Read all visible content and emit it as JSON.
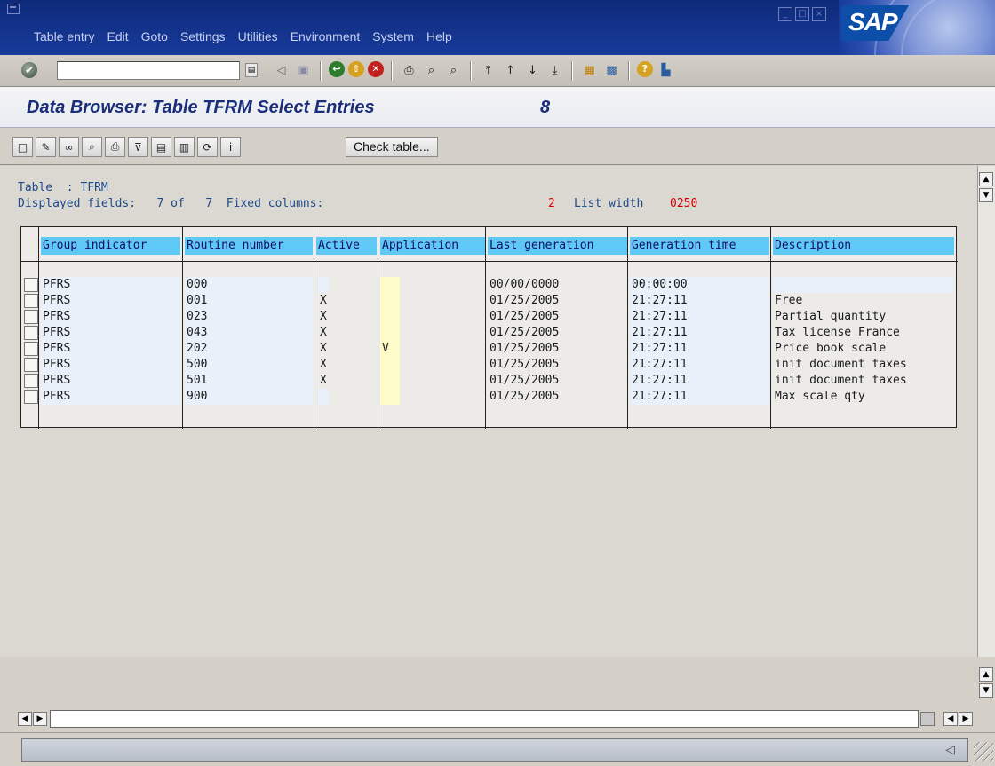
{
  "menubar": {
    "items": [
      "Table entry",
      "Edit",
      "Goto",
      "Settings",
      "Utilities",
      "Environment",
      "System",
      "Help"
    ]
  },
  "logo": "SAP",
  "title": {
    "text": "Data Browser: Table TFRM Select Entries",
    "count": "8"
  },
  "app_toolbar": {
    "check_table_label": "Check table..."
  },
  "header": {
    "table_line": "Table  : TFRM",
    "fields_line": "Displayed fields:   7 of   7  Fixed columns:",
    "fixed_columns_value": "2",
    "list_width_label": "List width",
    "list_width_value": "0250"
  },
  "table": {
    "columns": [
      "Group indicator",
      "Routine number",
      "Active",
      "Application",
      "Last generation",
      "Generation time",
      "Description"
    ],
    "rows": [
      {
        "group": "PFRS",
        "routine": "000",
        "active": "",
        "application": "",
        "last_gen": "00/00/0000",
        "gen_time": "00:00:00",
        "description": ""
      },
      {
        "group": "PFRS",
        "routine": "001",
        "active": "X",
        "application": "",
        "last_gen": "01/25/2005",
        "gen_time": "21:27:11",
        "description": "Free"
      },
      {
        "group": "PFRS",
        "routine": "023",
        "active": "X",
        "application": "",
        "last_gen": "01/25/2005",
        "gen_time": "21:27:11",
        "description": "Partial quantity"
      },
      {
        "group": "PFRS",
        "routine": "043",
        "active": "X",
        "application": "",
        "last_gen": "01/25/2005",
        "gen_time": "21:27:11",
        "description": "Tax license France"
      },
      {
        "group": "PFRS",
        "routine": "202",
        "active": "X",
        "application": "V",
        "last_gen": "01/25/2005",
        "gen_time": "21:27:11",
        "description": "Price book scale"
      },
      {
        "group": "PFRS",
        "routine": "500",
        "active": "X",
        "application": "",
        "last_gen": "01/25/2005",
        "gen_time": "21:27:11",
        "description": "init document taxes"
      },
      {
        "group": "PFRS",
        "routine": "501",
        "active": "X",
        "application": "",
        "last_gen": "01/25/2005",
        "gen_time": "21:27:11",
        "description": "init document taxes"
      },
      {
        "group": "PFRS",
        "routine": "900",
        "active": "",
        "application": "",
        "last_gen": "01/25/2005",
        "gen_time": "21:27:11",
        "description": "Max scale qty"
      }
    ]
  },
  "command_field": {
    "value": ""
  },
  "colors": {
    "title_blue": "#1b2e7a",
    "header_cyan": "#5ec9f5",
    "key_cell": "#e8f1fa",
    "input_cell": "#fdfbc8",
    "warning_red": "#e00000"
  }
}
